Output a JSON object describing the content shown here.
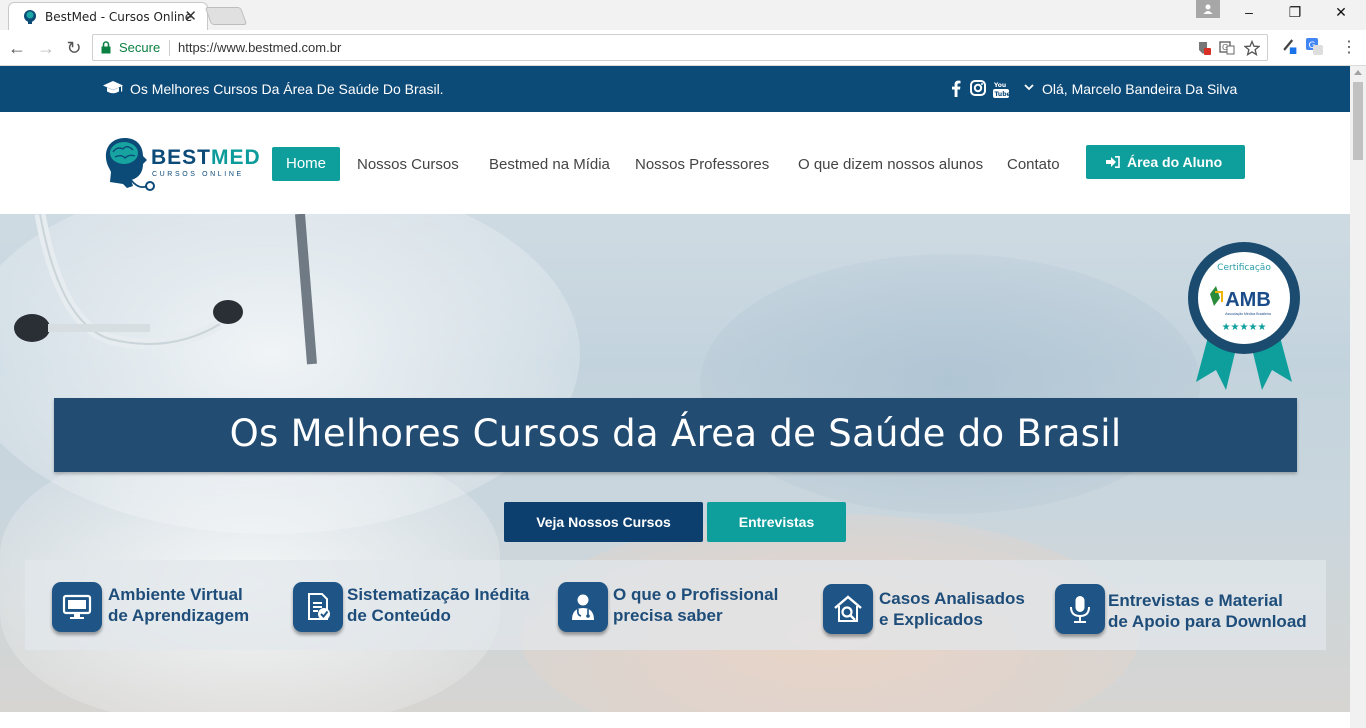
{
  "browser": {
    "tab_title": "BestMed - Cursos Online",
    "secure_label": "Secure",
    "url": "https://www.bestmed.com.br",
    "window_controls": {
      "minimize": "–",
      "restore": "❐",
      "close": "✕"
    }
  },
  "topbar": {
    "tagline": "Os Melhores Cursos Da Área De Saúde Do Brasil.",
    "greeting": "Olá, Marcelo Bandeira Da Silva",
    "social": [
      "facebook-icon",
      "instagram-icon",
      "youtube-icon"
    ]
  },
  "logo": {
    "brand_a": "BEST",
    "brand_b": "MED",
    "sub": "CURSOS ONLINE"
  },
  "nav": {
    "items": [
      "Home",
      "Nossos Cursos",
      "Bestmed na Mídia",
      "Nossos Professores",
      "O que dizem nossos alunos",
      "Contato"
    ],
    "cta": "Área do Aluno"
  },
  "hero": {
    "headline": "Os Melhores Cursos da Área de Saúde do Brasil",
    "btn_primary": "Veja Nossos Cursos",
    "btn_secondary": "Entrevistas",
    "badge": {
      "top": "Certificação",
      "org": "AMB",
      "sub": "Associação Médica Brasileira"
    },
    "features": [
      {
        "line1": "Ambiente Virtual",
        "line2": "de Aprendizagem",
        "icon": "monitor-icon"
      },
      {
        "line1": "Sistematização Inédita",
        "line2": "de Conteúdo",
        "icon": "document-check-icon"
      },
      {
        "line1": "O que o Profissional",
        "line2": "precisa saber",
        "icon": "doctor-icon"
      },
      {
        "line1": "Casos Analisados",
        "line2": "e Explicados",
        "icon": "house-search-icon"
      },
      {
        "line1": "Entrevistas e Material",
        "line2": "de Apoio para Download",
        "icon": "microphone-icon"
      }
    ]
  },
  "colors": {
    "navy": "#0c4a78",
    "teal": "#0e9f9c",
    "banner": "#224c72"
  }
}
